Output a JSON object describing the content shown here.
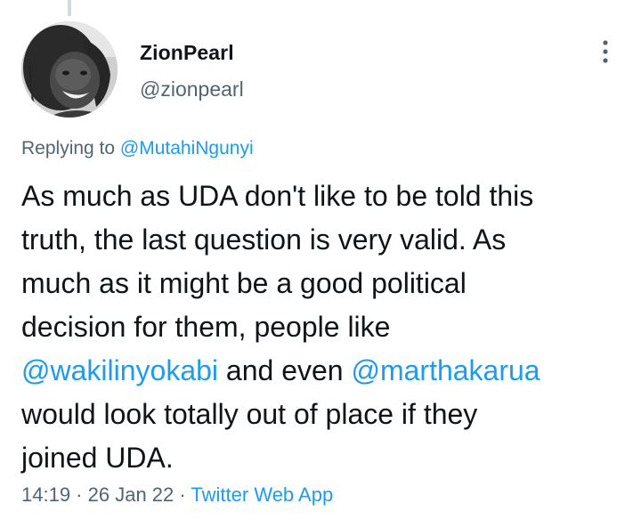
{
  "tweet": {
    "display_name": "ZionPearl",
    "handle": "@zionpearl",
    "replying_prefix": "Replying to ",
    "replying_to": "@MutahiNgunyi",
    "body": {
      "line1": "As much as UDA don't like to be told this",
      "line2": "truth, the last question is very valid. As",
      "line3": "much as it might be a good political",
      "line4": "decision for them, people like",
      "mention1": "@wakilinyokabi",
      "line5_mid": " and even ",
      "mention2": "@marthakarua",
      "line6": "would look totally out of place if they",
      "line7": "joined UDA."
    },
    "time": "14:19",
    "separator": " · ",
    "date": "26 Jan 22",
    "source": "Twitter Web App"
  },
  "colors": {
    "text": "#0f1419",
    "secondary": "#536471",
    "link": "#1d9bf0",
    "thread_line": "#cfd9de"
  },
  "icons": {
    "more": "more-vertical-icon",
    "avatar": "profile-photo"
  }
}
